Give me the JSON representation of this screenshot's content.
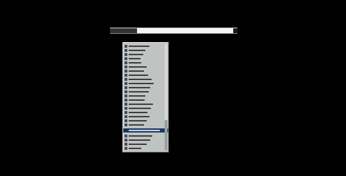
{
  "screen": {
    "background_color": "#000000"
  },
  "address_bar": {
    "value": "",
    "has_selection": true
  },
  "dropdown": {
    "item_count": 23,
    "selected_index": 20
  },
  "colors": {
    "panel": "#bfc3c2",
    "selection": "#1e3a64"
  }
}
